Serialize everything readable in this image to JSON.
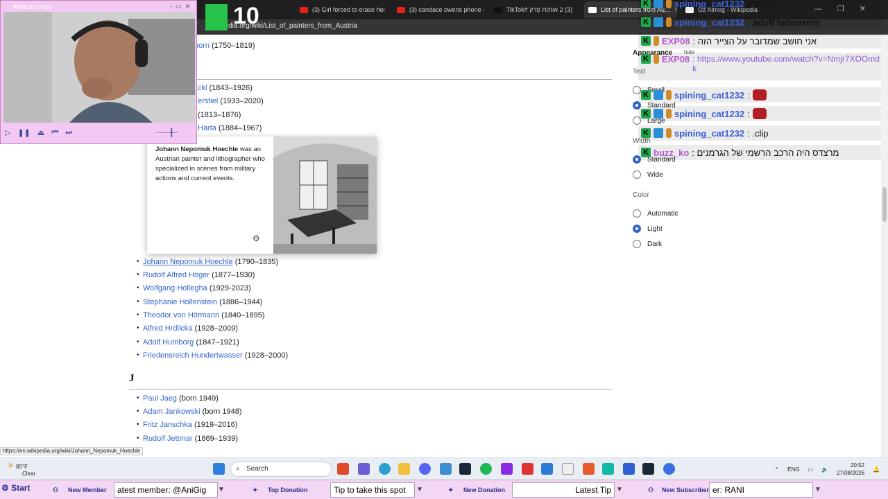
{
  "browser": {
    "tabs": [
      {
        "label": "(3) Girl forced to erase her dr...",
        "icon": "youtube-icon"
      },
      {
        "label": "(3) candace owens phone - Yo...",
        "icon": "youtube-icon"
      },
      {
        "label": "TikTok# ‏2 אותות פרק ‎(3)",
        "icon": "tiktok-icon"
      },
      {
        "label": "List of painters from Au...",
        "icon": "wikipedia-icon",
        "active": true
      },
      {
        "label": "Oz Almog - Wikipedia",
        "icon": "wikipedia-icon"
      }
    ],
    "url": "pedia.org/wiki/List_of_painters_from_Austria",
    "status_url": "https://en.wikipedia.org/wiki/Johann_Nepomuk_Hoechle"
  },
  "webcam": {
    "title": "Webcam.mp4"
  },
  "overlay": {
    "counter": "10"
  },
  "entries_top": [
    {
      "name": "born",
      "dates": "(1750–1819)"
    },
    {
      "name": "ckl",
      "dates": "(1843–1926)"
    },
    {
      "name": "erstiel",
      "dates": "(1933–2020)"
    },
    {
      "name": "",
      "dates": "(1813–1876)"
    },
    {
      "name": "Harta",
      "dates": "(1884–1967)"
    }
  ],
  "entries": [
    {
      "name": "Johann Nepomuk Hoechle",
      "dates": "(1790–1835)"
    },
    {
      "name": "Rudolf Alfred Höger",
      "dates": "(1877–1930)"
    },
    {
      "name": "Wolfgang Hollegha",
      "dates": "(1929-2023)"
    },
    {
      "name": "Stephanie Hollenstein",
      "dates": "(1886–1944)"
    },
    {
      "name": "Theodor von Hörmann",
      "dates": "(1840–1895)"
    },
    {
      "name": "Alfred Hrdlicka",
      "dates": "(1928–2009)"
    },
    {
      "name": "Adolf Humborg",
      "dates": "(1847–1921)"
    },
    {
      "name": "Friedensreich Hundertwasser",
      "dates": "(1928–2000)"
    }
  ],
  "section_j": {
    "letter": "J",
    "entries": [
      {
        "name": "Paul Jaeg",
        "dates": "(born 1949)"
      },
      {
        "name": "Adam Jankowski",
        "dates": "(born 1948)"
      },
      {
        "name": "Fritz Janschka",
        "dates": "(1919–2016)"
      },
      {
        "name": "Rudolf Jettmar",
        "dates": "(1869–1939)"
      }
    ]
  },
  "popup": {
    "title": "Johann Nepomuk Hoechle",
    "text": " was an Austrian painter and lithographer who specialized in scenes from military actions and current events."
  },
  "appearance": {
    "heading": "Appearance",
    "hide": "hide",
    "text_label": "Text",
    "text_options": [
      {
        "label": "Small"
      },
      {
        "label": "Standard",
        "on": true
      },
      {
        "label": "Large"
      }
    ],
    "width_label": "Width",
    "width_options": [
      {
        "label": "Standard",
        "on": true
      },
      {
        "label": "Wide"
      }
    ],
    "color_label": "Color",
    "color_options": [
      {
        "label": "Automatic"
      },
      {
        "label": "Light",
        "on": true
      },
      {
        "label": "Dark"
      }
    ]
  },
  "chat": [
    {
      "user": "spining_cat1232",
      "msg": "הארק :",
      "user_color": "#3b5fd6"
    },
    {
      "user": "spining_cat1232",
      "msg": ": adolf hitlerrrrrrr",
      "user_color": "#3b5fd6"
    },
    {
      "user": "EXP08",
      "msg": ": אני חושב שמדובר על הצייר הזה",
      "user_color": "#b25ad0"
    },
    {
      "user": "EXP08",
      "msg": ": https://www.youtube.com/watch?v=Nmjr7XOOmdk",
      "user_color": "#b25ad0"
    },
    {
      "user": "spining_cat1232",
      "msg": ":",
      "user_color": "#3b5fd6",
      "emote": true
    },
    {
      "user": "spining_cat1232",
      "msg": ":",
      "user_color": "#3b5fd6",
      "emote": true
    },
    {
      "user": "spining_cat1232",
      "msg": ": .clip",
      "user_color": "#3b5fd6"
    },
    {
      "user": "buzz_ko",
      "msg": ": מרצדס היה הרכב הרשמי של הגרמנים",
      "user_color": "#b25ad0"
    }
  ],
  "taskbar": {
    "weather_temp": "85°F",
    "weather_cond": "Clear",
    "search": "Search",
    "lang": "ENG",
    "time": "20:52",
    "date": "27/08/2026"
  },
  "streambar": {
    "start": "Start",
    "new_member_label": "New Member",
    "new_member_value": "atest member: @AniGig",
    "top_donation_label": "Top Donation",
    "top_donation_value": "Tip to take this spot",
    "new_donation_label": "New Donation",
    "new_donation_value": "Latest Tip",
    "new_sub_label": "New Subscriber",
    "new_sub_value": "er: RANI"
  }
}
